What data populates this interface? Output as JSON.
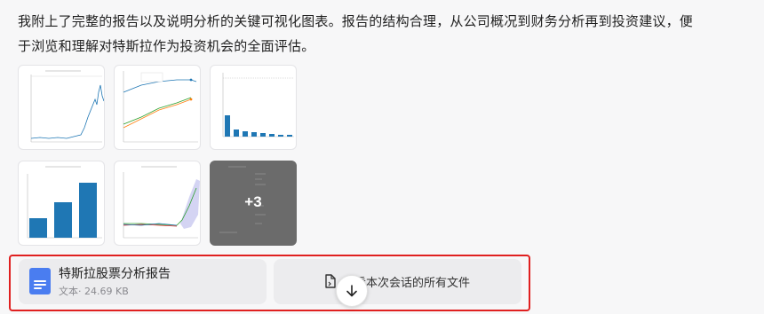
{
  "message": {
    "text": "我附上了完整的报告以及说明分析的关键可视化图表。报告的结构合理，从公司概况到财务分析再到投资建议，便于浏览和理解对特斯拉作为投资机会的全面评估。"
  },
  "thumbnails": {
    "items": [
      {
        "kind": "stock-price-line-chart"
      },
      {
        "kind": "multi-line-chart"
      },
      {
        "kind": "bar-chart"
      },
      {
        "kind": "revenue-bar-chart"
      },
      {
        "kind": "forecast-line-chart"
      },
      {
        "kind": "more-overlay"
      }
    ],
    "more_label": "+3"
  },
  "attachment": {
    "name": "特斯拉股票分析报告",
    "meta": "文本· 24.69 KB",
    "icon": "doc-icon",
    "icon_color": "#4a7df0"
  },
  "all_files": {
    "label": "查看本次会话的所有文件",
    "icon": "files-icon"
  },
  "scroll_button": {
    "icon": "arrow-down-icon"
  },
  "colors": {
    "highlight_frame": "#e02020",
    "chart_blue": "#1f77b4",
    "chart_orange": "#ff7f0e",
    "chart_green": "#2ca02c"
  }
}
